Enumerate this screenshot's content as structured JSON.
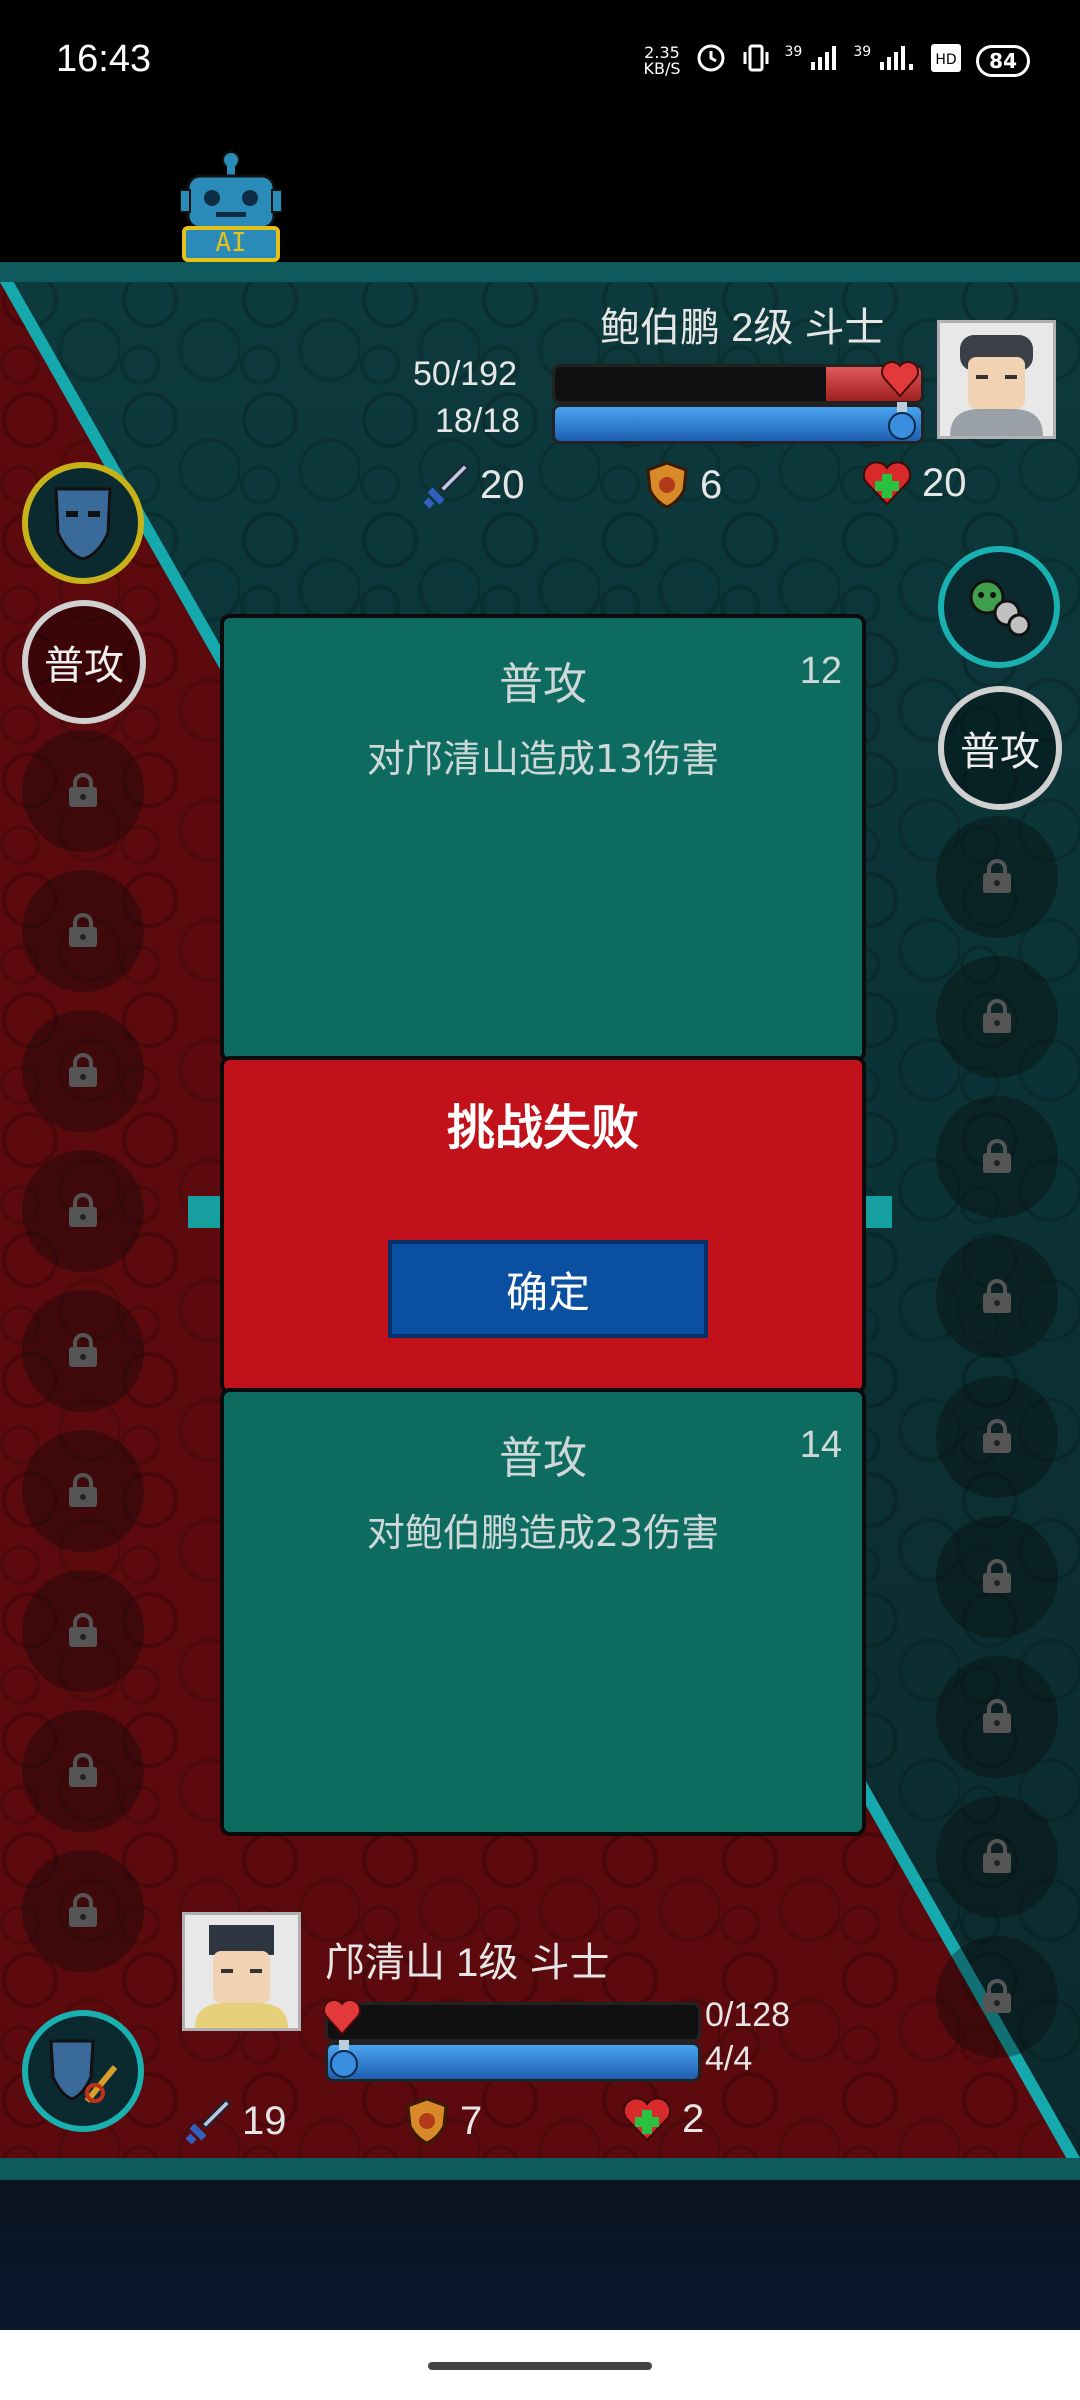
{
  "status_bar": {
    "time": "16:43",
    "net_speed": "2.35\nKB/S",
    "signal1": "39",
    "signal2": "39",
    "battery": "84",
    "icons": [
      "alarm-icon",
      "vibrate-icon",
      "signal-icon",
      "signal-icon",
      "hd-icon",
      "battery-icon"
    ]
  },
  "ai_button": {
    "label": "AI"
  },
  "enemy": {
    "name": "鲍伯鹏 2级 斗士",
    "hp_text": "50/192",
    "hp_fraction": 0.26,
    "mp_text": "18/18",
    "mp_fraction": 1.0,
    "attack": "20",
    "defense": "6",
    "heal": "20",
    "skill_label": "普攻"
  },
  "player": {
    "name": "邝清山 1级 斗士",
    "hp_text": "0/128",
    "hp_fraction": 0.0,
    "mp_text": "4/4",
    "mp_fraction": 1.0,
    "attack": "19",
    "defense": "7",
    "heal": "2",
    "skill_label": "普攻"
  },
  "log_top": {
    "title": "普攻",
    "round": "12",
    "text": "对邝清山造成13伤害"
  },
  "dialog": {
    "title": "挑战失败",
    "confirm": "确定"
  },
  "log_bottom": {
    "title": "普攻",
    "round": "14",
    "text": "对鲍伯鹏造成23伤害"
  },
  "colors": {
    "teal_panel": "#0e6b60",
    "dialog_red": "#c1121b",
    "confirm_blue": "#0b4fa0",
    "accent_teal": "#19b0b0"
  }
}
